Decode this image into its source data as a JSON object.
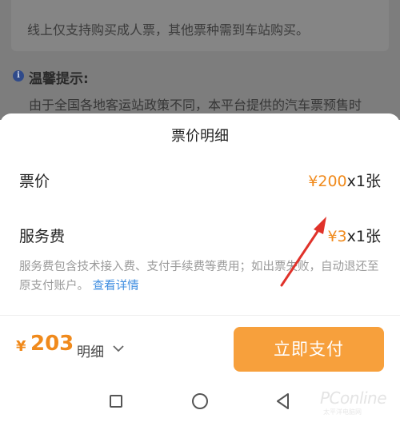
{
  "background": {
    "notice_text": "线上仅支持购买成人票，其他票种需到车站购买。",
    "tip_icon": "i",
    "tip_title": "温馨提示:",
    "tip_text": "由于全国各地客运站政策不同，本平台提供的汽车票预售时"
  },
  "sheet": {
    "title": "票价明细",
    "ticket": {
      "label": "票价",
      "price": "¥200",
      "qty": "x1张"
    },
    "service": {
      "label": "服务费",
      "price": "¥3",
      "qty": "x1张"
    },
    "fee_note": "服务费包含技术接入费、支付手续费等费用；如出票失败，自动退还至原支付账户。",
    "fee_link": "查看详情"
  },
  "pay_bar": {
    "currency": "¥",
    "total": "203",
    "detail_label": "明细",
    "pay_label": "立即支付"
  },
  "watermark": {
    "brand": "PConline",
    "sub": "太平洋电脑网"
  },
  "colors": {
    "accent": "#f08a1c",
    "button": "#f7a03c",
    "link": "#3e8de0",
    "arrow": "#e0322a"
  }
}
